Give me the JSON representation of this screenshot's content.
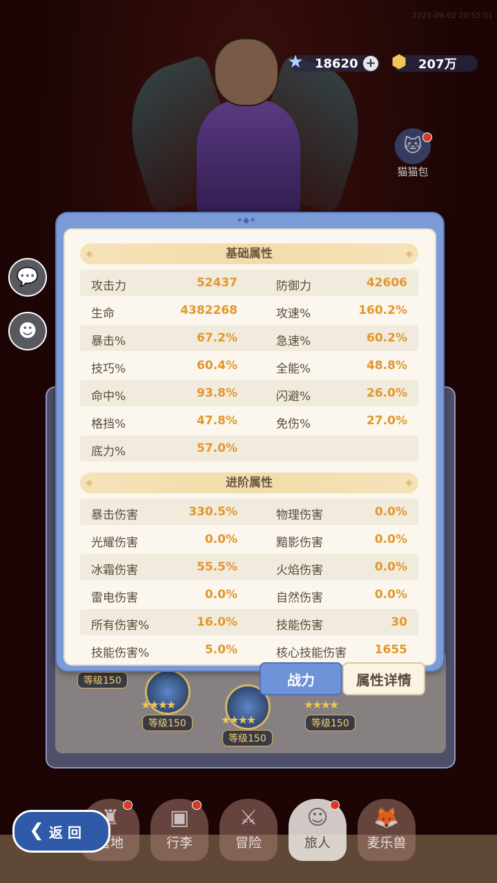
{
  "timestamp": "2025-09-02 20:55:01",
  "currencies": {
    "gems": "18620",
    "gold": "207万"
  },
  "side": {
    "cat_bag": "猫猫包"
  },
  "team": {
    "levels": [
      "等级150",
      "等级150",
      "等级150",
      "等级150"
    ]
  },
  "basic": {
    "title": "基础属性",
    "rows": [
      {
        "l1": "攻击力",
        "v1": "52437",
        "l2": "防御力",
        "v2": "42606"
      },
      {
        "l1": "生命",
        "v1": "4382268",
        "l2": "攻速%",
        "v2": "160.2%"
      },
      {
        "l1": "暴击%",
        "v1": "67.2%",
        "l2": "急速%",
        "v2": "60.2%"
      },
      {
        "l1": "技巧%",
        "v1": "60.4%",
        "l2": "全能%",
        "v2": "48.8%"
      },
      {
        "l1": "命中%",
        "v1": "93.8%",
        "l2": "闪避%",
        "v2": "26.0%"
      },
      {
        "l1": "格挡%",
        "v1": "47.8%",
        "l2": "免伤%",
        "v2": "27.0%"
      },
      {
        "l1": "底力%",
        "v1": "57.0%",
        "l2": "",
        "v2": ""
      }
    ]
  },
  "advanced": {
    "title": "进阶属性",
    "rows": [
      {
        "l1": "暴击伤害",
        "v1": "330.5%",
        "l2": "物理伤害",
        "v2": "0.0%"
      },
      {
        "l1": "光耀伤害",
        "v1": "0.0%",
        "l2": "黯影伤害",
        "v2": "0.0%"
      },
      {
        "l1": "冰霜伤害",
        "v1": "55.5%",
        "l2": "火焰伤害",
        "v2": "0.0%"
      },
      {
        "l1": "雷电伤害",
        "v1": "0.0%",
        "l2": "自然伤害",
        "v2": "0.0%"
      },
      {
        "l1": "所有伤害%",
        "v1": "16.0%",
        "l2": "技能伤害",
        "v2": "30"
      },
      {
        "l1": "技能伤害%",
        "v1": "5.0%",
        "l2": "核心技能伤害",
        "v2": "1655"
      }
    ]
  },
  "tabs": {
    "power": "战力",
    "detail": "属性详情"
  },
  "nav": {
    "items": [
      "营地",
      "行李",
      "冒险",
      "旅人",
      "麦乐兽"
    ]
  },
  "back_label": "返 回"
}
